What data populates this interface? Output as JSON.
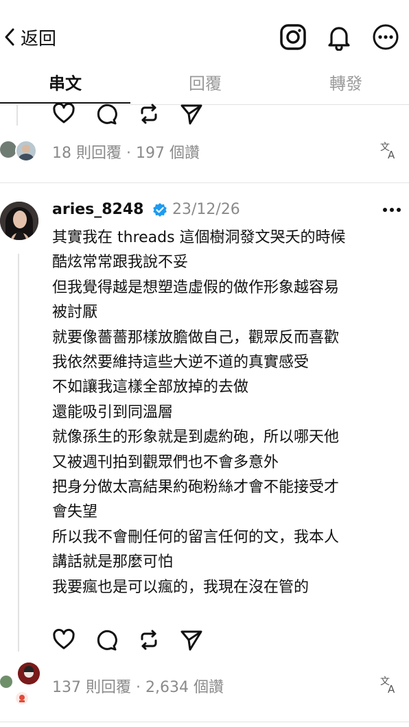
{
  "header": {
    "back_label": "返回",
    "icons": [
      "chevron-left-icon",
      "instagram-icon",
      "bell-icon",
      "more-icon"
    ]
  },
  "tabs": [
    {
      "label": "串文",
      "active": true
    },
    {
      "label": "回覆",
      "active": false
    },
    {
      "label": "轉發",
      "active": false
    }
  ],
  "previous_post": {
    "stats": "18 則回覆 · 197 個讚"
  },
  "post": {
    "username": "aries_8248",
    "verified": true,
    "date": "23/12/26",
    "lines": [
      "其實我在 threads 這個樹洞發文哭夭的時候",
      "酷炫常常跟我說不妥",
      "但我覺得越是想塑造虛假的做作形象越容易",
      "被討厭",
      "就要像薔薔那樣放膽做自己，觀眾反而喜歡",
      "我依然要維持這些大逆不道的真實感受",
      "不如讓我這樣全部放掉的去做",
      "還能吸引到同溫層",
      "就像孫生的形象就是到處約砲，所以哪天他",
      "又被週刊拍到觀眾們也不會多意外",
      "把身分做太高結果約砲粉絲才會不能接受才",
      "會失望",
      "所以我不會刪任何的留言任何的文，我本人",
      "講話就是那麼可怕",
      "我要瘋也是可以瘋的，我現在沒在管的"
    ],
    "stats": "137 則回覆 · 2,634 個讚"
  },
  "colors": {
    "verified": "#1d9bf0",
    "muted": "#8a8a8a",
    "text": "#111111"
  }
}
